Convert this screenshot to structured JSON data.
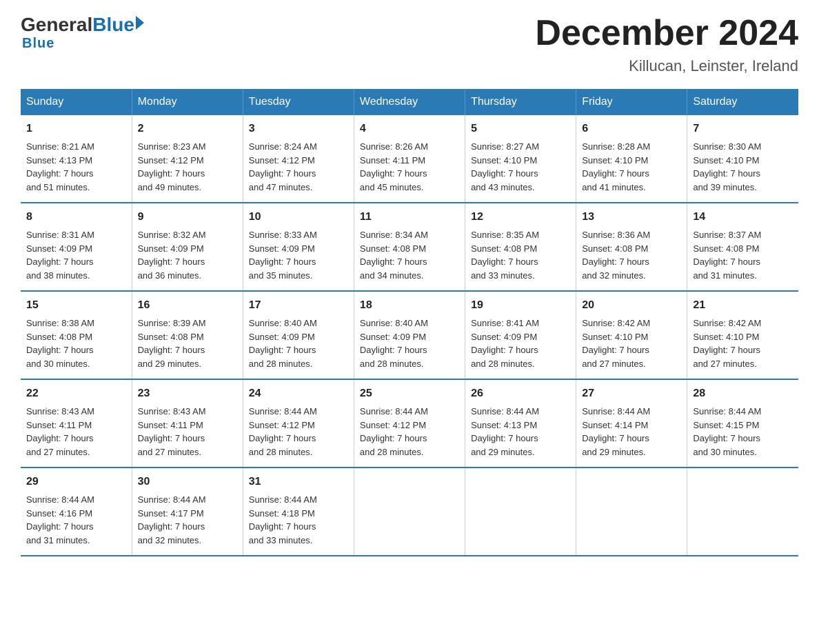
{
  "logo": {
    "general": "General",
    "blue": "Blue",
    "underline": "Blue"
  },
  "title": "December 2024",
  "location": "Killucan, Leinster, Ireland",
  "days_header": [
    "Sunday",
    "Monday",
    "Tuesday",
    "Wednesday",
    "Thursday",
    "Friday",
    "Saturday"
  ],
  "weeks": [
    [
      {
        "day": "1",
        "sunrise": "8:21 AM",
        "sunset": "4:13 PM",
        "daylight": "7 hours and 51 minutes."
      },
      {
        "day": "2",
        "sunrise": "8:23 AM",
        "sunset": "4:12 PM",
        "daylight": "7 hours and 49 minutes."
      },
      {
        "day": "3",
        "sunrise": "8:24 AM",
        "sunset": "4:12 PM",
        "daylight": "7 hours and 47 minutes."
      },
      {
        "day": "4",
        "sunrise": "8:26 AM",
        "sunset": "4:11 PM",
        "daylight": "7 hours and 45 minutes."
      },
      {
        "day": "5",
        "sunrise": "8:27 AM",
        "sunset": "4:10 PM",
        "daylight": "7 hours and 43 minutes."
      },
      {
        "day": "6",
        "sunrise": "8:28 AM",
        "sunset": "4:10 PM",
        "daylight": "7 hours and 41 minutes."
      },
      {
        "day": "7",
        "sunrise": "8:30 AM",
        "sunset": "4:10 PM",
        "daylight": "7 hours and 39 minutes."
      }
    ],
    [
      {
        "day": "8",
        "sunrise": "8:31 AM",
        "sunset": "4:09 PM",
        "daylight": "7 hours and 38 minutes."
      },
      {
        "day": "9",
        "sunrise": "8:32 AM",
        "sunset": "4:09 PM",
        "daylight": "7 hours and 36 minutes."
      },
      {
        "day": "10",
        "sunrise": "8:33 AM",
        "sunset": "4:09 PM",
        "daylight": "7 hours and 35 minutes."
      },
      {
        "day": "11",
        "sunrise": "8:34 AM",
        "sunset": "4:08 PM",
        "daylight": "7 hours and 34 minutes."
      },
      {
        "day": "12",
        "sunrise": "8:35 AM",
        "sunset": "4:08 PM",
        "daylight": "7 hours and 33 minutes."
      },
      {
        "day": "13",
        "sunrise": "8:36 AM",
        "sunset": "4:08 PM",
        "daylight": "7 hours and 32 minutes."
      },
      {
        "day": "14",
        "sunrise": "8:37 AM",
        "sunset": "4:08 PM",
        "daylight": "7 hours and 31 minutes."
      }
    ],
    [
      {
        "day": "15",
        "sunrise": "8:38 AM",
        "sunset": "4:08 PM",
        "daylight": "7 hours and 30 minutes."
      },
      {
        "day": "16",
        "sunrise": "8:39 AM",
        "sunset": "4:08 PM",
        "daylight": "7 hours and 29 minutes."
      },
      {
        "day": "17",
        "sunrise": "8:40 AM",
        "sunset": "4:09 PM",
        "daylight": "7 hours and 28 minutes."
      },
      {
        "day": "18",
        "sunrise": "8:40 AM",
        "sunset": "4:09 PM",
        "daylight": "7 hours and 28 minutes."
      },
      {
        "day": "19",
        "sunrise": "8:41 AM",
        "sunset": "4:09 PM",
        "daylight": "7 hours and 28 minutes."
      },
      {
        "day": "20",
        "sunrise": "8:42 AM",
        "sunset": "4:10 PM",
        "daylight": "7 hours and 27 minutes."
      },
      {
        "day": "21",
        "sunrise": "8:42 AM",
        "sunset": "4:10 PM",
        "daylight": "7 hours and 27 minutes."
      }
    ],
    [
      {
        "day": "22",
        "sunrise": "8:43 AM",
        "sunset": "4:11 PM",
        "daylight": "7 hours and 27 minutes."
      },
      {
        "day": "23",
        "sunrise": "8:43 AM",
        "sunset": "4:11 PM",
        "daylight": "7 hours and 27 minutes."
      },
      {
        "day": "24",
        "sunrise": "8:44 AM",
        "sunset": "4:12 PM",
        "daylight": "7 hours and 28 minutes."
      },
      {
        "day": "25",
        "sunrise": "8:44 AM",
        "sunset": "4:12 PM",
        "daylight": "7 hours and 28 minutes."
      },
      {
        "day": "26",
        "sunrise": "8:44 AM",
        "sunset": "4:13 PM",
        "daylight": "7 hours and 29 minutes."
      },
      {
        "day": "27",
        "sunrise": "8:44 AM",
        "sunset": "4:14 PM",
        "daylight": "7 hours and 29 minutes."
      },
      {
        "day": "28",
        "sunrise": "8:44 AM",
        "sunset": "4:15 PM",
        "daylight": "7 hours and 30 minutes."
      }
    ],
    [
      {
        "day": "29",
        "sunrise": "8:44 AM",
        "sunset": "4:16 PM",
        "daylight": "7 hours and 31 minutes."
      },
      {
        "day": "30",
        "sunrise": "8:44 AM",
        "sunset": "4:17 PM",
        "daylight": "7 hours and 32 minutes."
      },
      {
        "day": "31",
        "sunrise": "8:44 AM",
        "sunset": "4:18 PM",
        "daylight": "7 hours and 33 minutes."
      },
      null,
      null,
      null,
      null
    ]
  ],
  "labels": {
    "sunrise": "Sunrise:",
    "sunset": "Sunset:",
    "daylight": "Daylight:"
  }
}
